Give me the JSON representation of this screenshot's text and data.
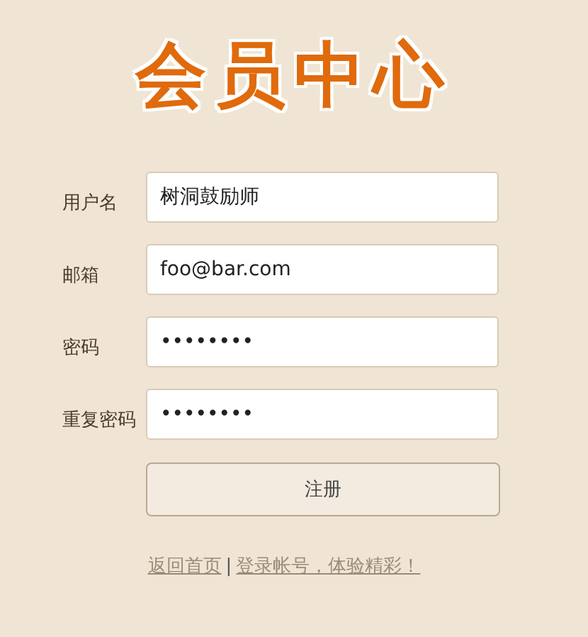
{
  "title": "会员中心",
  "fields": [
    {
      "label": "用户名",
      "value": "树洞鼓励师"
    },
    {
      "label": "邮箱",
      "value": "foo@bar.com"
    },
    {
      "label": "密码",
      "value": "••••••••"
    },
    {
      "label": "重复密码",
      "value": "••••••••"
    }
  ],
  "submit": "注册",
  "links": [
    {
      "text": "返回首页"
    },
    {
      "text": "登录帐号，体验精彩！"
    }
  ],
  "separator": "|"
}
